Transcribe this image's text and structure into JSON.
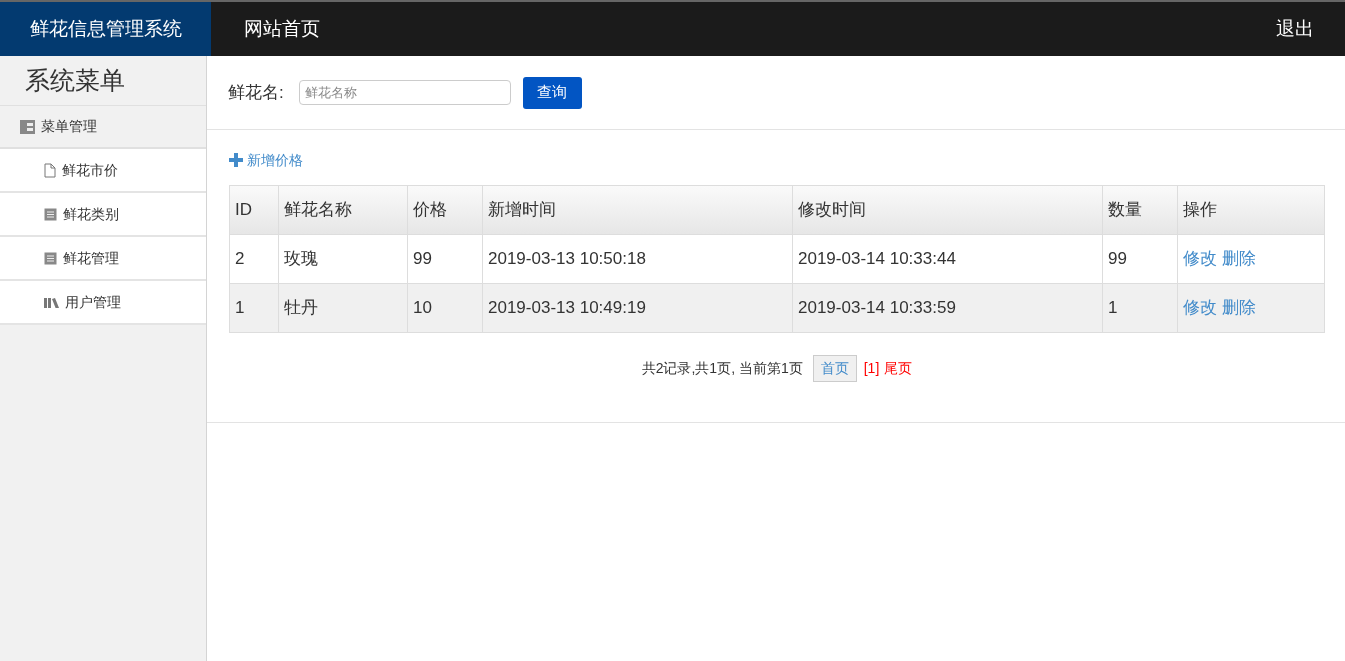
{
  "header": {
    "brand": "鲜花信息管理系统",
    "nav": "网站首页",
    "logout": "退出"
  },
  "sidebar": {
    "title": "系统菜单",
    "group": {
      "label": "菜单管理",
      "children": [
        {
          "label": "鲜花市价"
        },
        {
          "label": "鲜花类别"
        },
        {
          "label": "鲜花管理"
        },
        {
          "label": "用户管理"
        }
      ]
    }
  },
  "search": {
    "label": "鲜花名:",
    "placeholder": "鲜花名称",
    "button": "查询"
  },
  "add_link": "新增价格",
  "table": {
    "columns": [
      "ID",
      "鲜花名称",
      "价格",
      "新增时间",
      "修改时间",
      "数量",
      "操作"
    ],
    "rows": [
      {
        "cells": [
          "2",
          "玫瑰",
          "99",
          "2019-03-13 10:50:18",
          "2019-03-14 10:33:44",
          "99"
        ],
        "actions": [
          "修改",
          "删除"
        ]
      },
      {
        "cells": [
          "1",
          "牡丹",
          "10",
          "2019-03-13 10:49:19",
          "2019-03-14 10:33:59",
          "1"
        ],
        "actions": [
          "修改",
          "删除"
        ]
      }
    ]
  },
  "pagination": {
    "summary": "共2记录,共1页, 当前第1页",
    "items": [
      {
        "label": "首页",
        "selected": true
      },
      {
        "label": "[1]",
        "selected": false
      },
      {
        "label": "尾页",
        "selected": false
      }
    ]
  }
}
